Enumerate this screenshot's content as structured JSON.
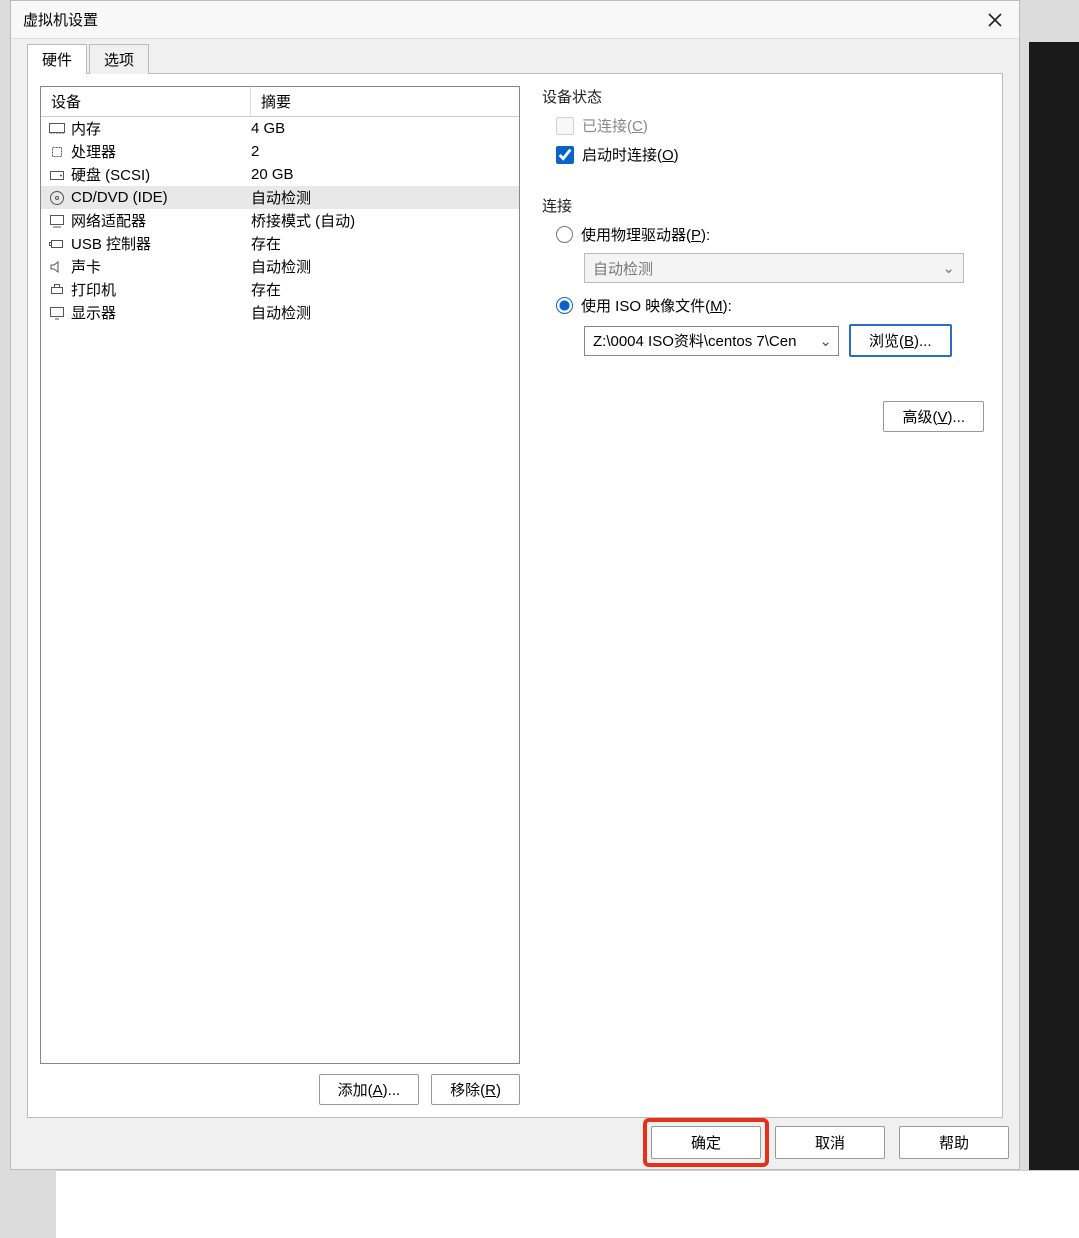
{
  "window": {
    "title": "虚拟机设置"
  },
  "tabs": {
    "hardware": "硬件",
    "options": "选项"
  },
  "table": {
    "header_device": "设备",
    "header_summary": "摘要",
    "rows": [
      {
        "icon": "memory",
        "name": "内存",
        "summary": "4 GB"
      },
      {
        "icon": "cpu",
        "name": "处理器",
        "summary": "2"
      },
      {
        "icon": "hdd",
        "name": "硬盘 (SCSI)",
        "summary": "20 GB"
      },
      {
        "icon": "disc",
        "name": "CD/DVD (IDE)",
        "summary": "自动检测"
      },
      {
        "icon": "net",
        "name": "网络适配器",
        "summary": "桥接模式 (自动)"
      },
      {
        "icon": "usb",
        "name": "USB 控制器",
        "summary": "存在"
      },
      {
        "icon": "sound",
        "name": "声卡",
        "summary": "自动检测"
      },
      {
        "icon": "printer",
        "name": "打印机",
        "summary": "存在"
      },
      {
        "icon": "display",
        "name": "显示器",
        "summary": "自动检测"
      }
    ]
  },
  "left_buttons": {
    "add_prefix": "添加(",
    "add_hotkey": "A",
    "add_suffix": ")...",
    "remove_prefix": "移除(",
    "remove_hotkey": "R",
    "remove_suffix": ")"
  },
  "status_group": {
    "title": "设备状态",
    "connected_prefix": "已连接(",
    "connected_hotkey": "C",
    "connected_suffix": ")",
    "connect_at_poweron_prefix": "启动时连接(",
    "connect_at_poweron_hotkey": "O",
    "connect_at_poweron_suffix": ")"
  },
  "connection_group": {
    "title": "连接",
    "physical_prefix": "使用物理驱动器(",
    "physical_hotkey": "P",
    "physical_suffix": "):",
    "physical_value": "自动检测",
    "iso_prefix": "使用 ISO 映像文件(",
    "iso_hotkey": "M",
    "iso_suffix": "):",
    "iso_path": "Z:\\0004 ISO资料\\centos 7\\Cen",
    "browse_prefix": "浏览(",
    "browse_hotkey": "B",
    "browse_suffix": ")..."
  },
  "advanced": {
    "prefix": "高级(",
    "hotkey": "V",
    "suffix": ")..."
  },
  "footer": {
    "ok": "确定",
    "cancel": "取消",
    "help": "帮助"
  }
}
